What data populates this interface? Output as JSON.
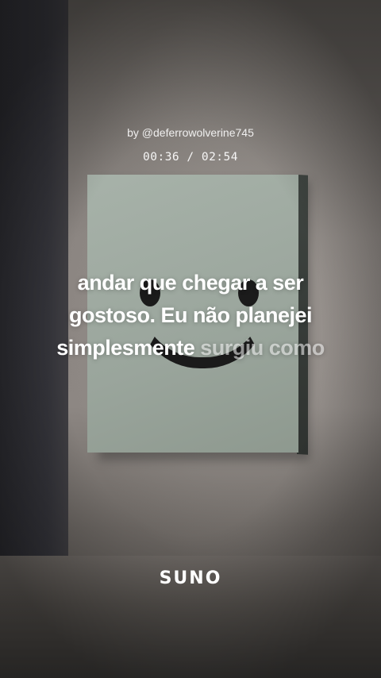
{
  "video": {
    "byline": "by @deferrowolverine745",
    "time": {
      "current": "00:36",
      "separator": "/",
      "total": "02:54",
      "display": "00:36 / 02:54"
    },
    "lyrics": {
      "line1": "andar que chegar a ser",
      "line2": "gostoso. Eu não planejei",
      "line3_sung": "simplesmente",
      "line3_upcoming": "surgiu como"
    },
    "logo": "SUNO"
  }
}
